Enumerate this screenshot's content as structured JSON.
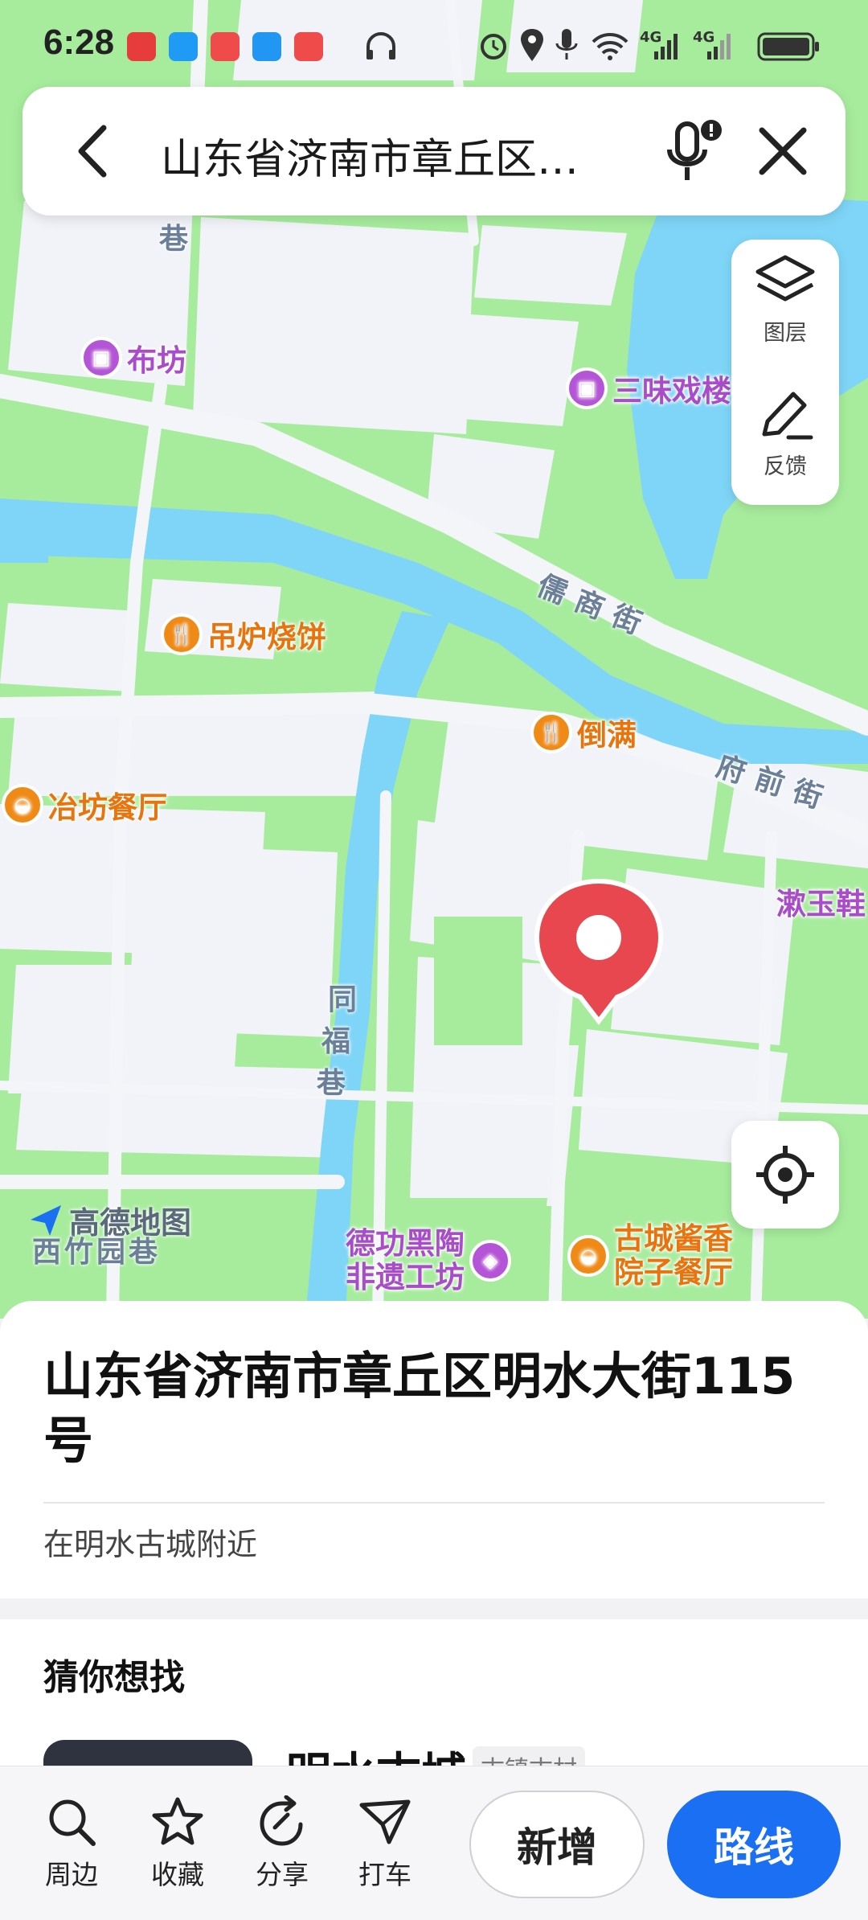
{
  "status_bar": {
    "time": "6:28",
    "network_1": "4G",
    "network_2": "4G"
  },
  "search": {
    "query": "山东省济南市章丘区…"
  },
  "map_controls": {
    "layers_label": "图层",
    "feedback_label": "反馈"
  },
  "map": {
    "pois": [
      {
        "name": "布坊",
        "type": "shop"
      },
      {
        "name": "三味戏楼",
        "type": "shop"
      },
      {
        "name": "吊炉烧饼",
        "type": "food"
      },
      {
        "name": "倒满",
        "type": "food"
      },
      {
        "name": "冶坊餐厅",
        "type": "food"
      },
      {
        "name": "德功黑陶",
        "name2": "非遗工坊",
        "type": "shop"
      },
      {
        "name": "古城酱香",
        "name2": "院子餐厅",
        "type": "food"
      },
      {
        "name": "漱玉鞋",
        "type": "shop"
      }
    ],
    "streets": [
      "巷",
      "儒商街",
      "府前街",
      "同",
      "福",
      "巷",
      "西竹园巷"
    ],
    "watermark": "高德地图"
  },
  "place": {
    "address": "山东省济南市章丘区明水大街115号",
    "nearby": "在明水古城附近"
  },
  "guess": {
    "title": "猜你想找",
    "item_name": "明水古城",
    "item_tag": "古镇古村"
  },
  "bottom_bar": {
    "nearby": "周边",
    "favorite": "收藏",
    "share": "分享",
    "taxi": "打车",
    "add": "新增",
    "route": "路线"
  },
  "colors": {
    "map_green": "#a7ec9d",
    "road": "#f4f5f9",
    "water": "#7fd5f7",
    "accent_blue": "#1a6ff2",
    "pin_red": "#e8474f"
  }
}
